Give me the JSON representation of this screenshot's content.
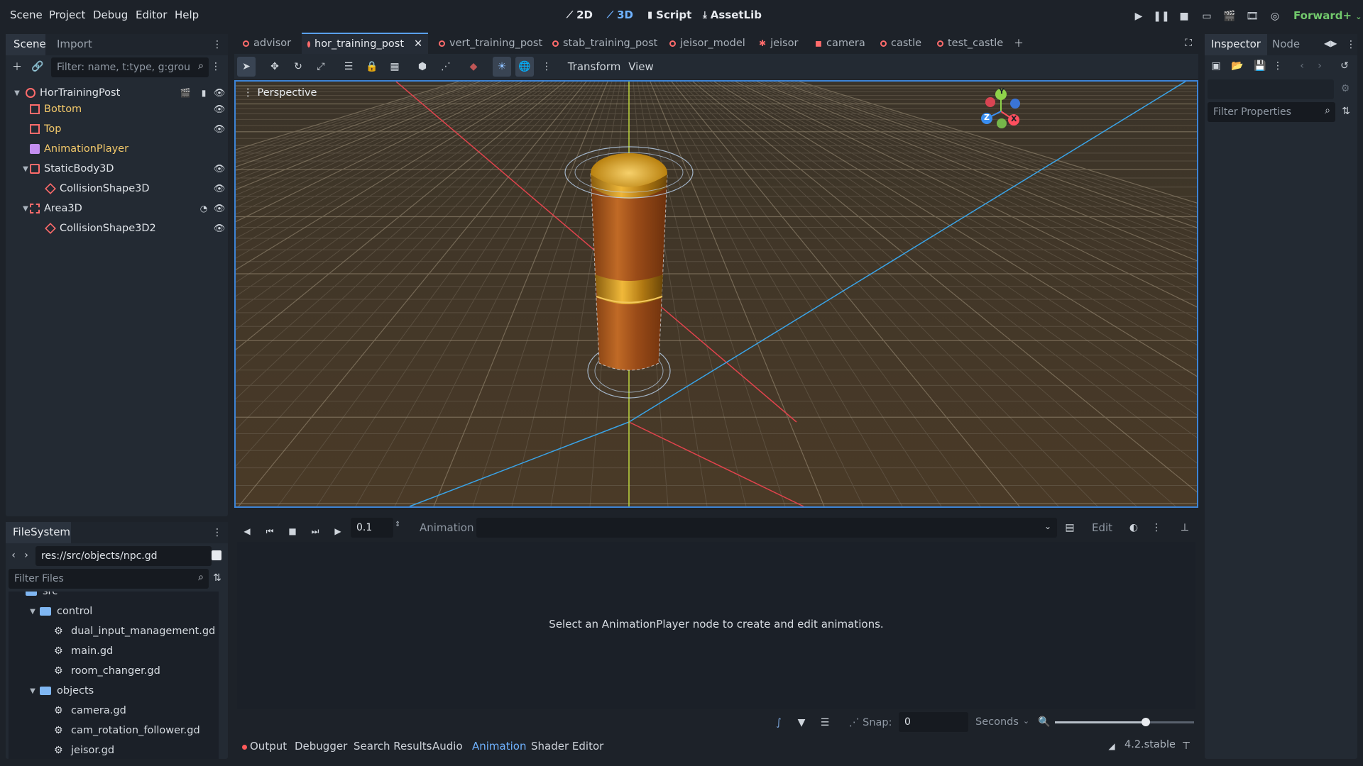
{
  "menu": [
    "Scene",
    "Project",
    "Debug",
    "Editor",
    "Help"
  ],
  "workspaces": [
    {
      "label": "2D",
      "icon": "2d-icon"
    },
    {
      "label": "3D",
      "icon": "3d-icon"
    },
    {
      "label": "Script",
      "icon": "script-icon"
    },
    {
      "label": "AssetLib",
      "icon": "assetlib-icon"
    }
  ],
  "renderer": "Forward+",
  "scene_dock": {
    "tabs": [
      "Scene",
      "Import"
    ],
    "filter_placeholder": "Filter: name, t:type, g:grou",
    "nodes": [
      {
        "label": "HorTrainingPost",
        "color": "#dfe3e8",
        "icon": "node3d-icon"
      },
      {
        "label": "Bottom",
        "color": "#f2c86a",
        "icon": "mesh-icon"
      },
      {
        "label": "Top",
        "color": "#f2c86a",
        "icon": "mesh-icon"
      },
      {
        "label": "AnimationPlayer",
        "color": "#f2c86a",
        "icon": "animation-player-icon"
      },
      {
        "label": "StaticBody3D",
        "color": "#dfe3e8",
        "icon": "staticbody-icon"
      },
      {
        "label": "CollisionShape3D",
        "color": "#dfe3e8",
        "icon": "collision-icon"
      },
      {
        "label": "Area3D",
        "color": "#dfe3e8",
        "icon": "area-icon"
      },
      {
        "label": "CollisionShape3D2",
        "color": "#dfe3e8",
        "icon": "collision-icon"
      }
    ]
  },
  "filesystem": {
    "tab": "FileSystem",
    "path": "res://src/objects/npc.gd",
    "filter_placeholder": "Filter Files",
    "items": [
      {
        "label": "src",
        "type": "folder"
      },
      {
        "label": "control",
        "type": "folder"
      },
      {
        "label": "dual_input_management.gd",
        "type": "file"
      },
      {
        "label": "main.gd",
        "type": "file"
      },
      {
        "label": "room_changer.gd",
        "type": "file"
      },
      {
        "label": "objects",
        "type": "folder"
      },
      {
        "label": "camera.gd",
        "type": "file"
      },
      {
        "label": "cam_rotation_follower.gd",
        "type": "file"
      },
      {
        "label": "jeisor.gd",
        "type": "file"
      }
    ]
  },
  "scene_tabs": [
    {
      "label": "advisor",
      "active": false
    },
    {
      "label": "hor_training_post",
      "active": true
    },
    {
      "label": "vert_training_post",
      "active": false
    },
    {
      "label": "stab_training_post",
      "active": false
    },
    {
      "label": "jeisor_model",
      "active": false
    },
    {
      "label": "jeisor",
      "active": false
    },
    {
      "label": "camera",
      "active": false
    },
    {
      "label": "castle",
      "active": false
    },
    {
      "label": "test_castle",
      "active": false
    }
  ],
  "viewport_toolbar": {
    "transform": "Transform",
    "view": "View"
  },
  "viewport": {
    "label": "Perspective",
    "gizmo": {
      "y": "Y",
      "x": "X",
      "z": "Z"
    }
  },
  "animation_panel": {
    "time": "0.1",
    "label": "Animation",
    "edit": "Edit",
    "empty_message": "Select an AnimationPlayer node to create and edit animations.",
    "snap_label": "Snap:",
    "snap_value": "0",
    "unit": "Seconds"
  },
  "bottom_tabs": [
    "Output",
    "Debugger",
    "Search Results",
    "Audio",
    "Animation",
    "Shader Editor"
  ],
  "active_bottom_tab": "Animation",
  "version": "4.2.stable",
  "inspector": {
    "tabs": [
      "Inspector",
      "Node"
    ],
    "filter_placeholder": "Filter Properties"
  }
}
